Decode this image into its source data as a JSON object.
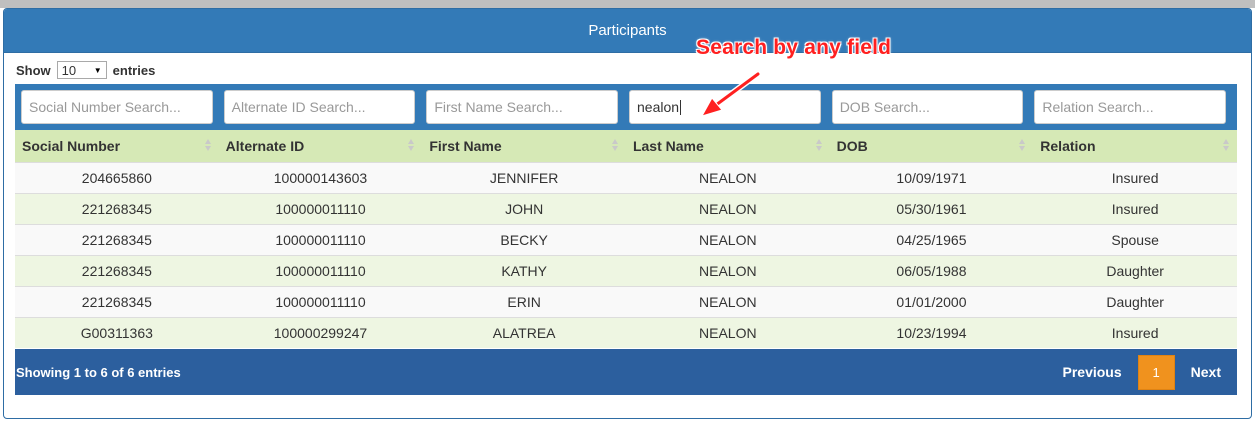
{
  "panel": {
    "title": "Participants"
  },
  "length": {
    "prefix": "Show",
    "value": "10",
    "suffix": "entries"
  },
  "filters": [
    {
      "placeholder": "Social Number Search...",
      "value": ""
    },
    {
      "placeholder": "Alternate ID Search...",
      "value": ""
    },
    {
      "placeholder": "First Name Search...",
      "value": ""
    },
    {
      "placeholder": "Last Name Search...",
      "value": "nealon"
    },
    {
      "placeholder": "DOB Search...",
      "value": ""
    },
    {
      "placeholder": "Relation Search...",
      "value": ""
    }
  ],
  "columns": [
    "Social Number",
    "Alternate ID",
    "First Name",
    "Last Name",
    "DOB",
    "Relation"
  ],
  "rows": [
    [
      "204665860",
      "100000143603",
      "JENNIFER",
      "NEALON",
      "10/09/1971",
      "Insured"
    ],
    [
      "221268345",
      "100000011110",
      "JOHN",
      "NEALON",
      "05/30/1961",
      "Insured"
    ],
    [
      "221268345",
      "100000011110",
      "BECKY",
      "NEALON",
      "04/25/1965",
      "Spouse"
    ],
    [
      "221268345",
      "100000011110",
      "KATHY",
      "NEALON",
      "06/05/1988",
      "Daughter"
    ],
    [
      "221268345",
      "100000011110",
      "ERIN",
      "NEALON",
      "01/01/2000",
      "Daughter"
    ],
    [
      "G00311363",
      "100000299247",
      "ALATREA",
      "NEALON",
      "10/23/1994",
      "Insured"
    ]
  ],
  "footer": {
    "info": "Showing 1 to 6 of 6 entries",
    "previous": "Previous",
    "current_page": "1",
    "next": "Next"
  },
  "annotation": {
    "text": "Search by any field",
    "color": "#ff2020"
  },
  "colors": {
    "header_blue": "#337ab7",
    "footer_blue": "#2c5f9e",
    "header_row_green": "#d6e9b6",
    "active_page": "#f0921e"
  }
}
